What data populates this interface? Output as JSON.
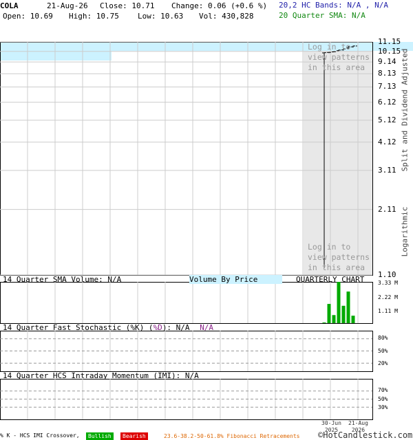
{
  "header": {
    "symbol": "COLA",
    "date": "21-Aug-26",
    "close_label": "Close: 10.71",
    "change_label": "Change: 0.06 (+0.6 %)",
    "open_label": "Open: 10.69",
    "high_label": "High: 10.75",
    "low_label": "Low: 10.63",
    "vol_label": "Vol: 430,828",
    "hc_bands": "20,2 HC Bands: N/A , N/A",
    "sma": "20 Quarter SMA: N/A"
  },
  "colors": {
    "hc_bands": "#2222aa",
    "sma": "#118811",
    "grid": "#cccccc",
    "shade": "#e8e8e8",
    "highlight": "#ccf2ff",
    "volume": "#00aa00",
    "bullish": "#00aa00",
    "bearish": "#dd0000",
    "fib": "#dd6600",
    "stoch_d": "#882288",
    "login_text": "#999999"
  },
  "side_label_top": "Split and Dividend Adjusted",
  "side_label_bottom": "Logarithmic",
  "login_text_top": [
    "Log in to",
    "view patterns",
    "in this area"
  ],
  "login_text_bottom": [
    "Log in to",
    "view patterns",
    "in this area"
  ],
  "price_axis": [
    "11.15",
    "10.15",
    "9.14",
    "8.13",
    "7.13",
    "6.12",
    "5.12",
    "4.12",
    "3.11",
    "2.11",
    "1.10"
  ],
  "volume_panel": {
    "title": "14 Quarter SMA Volume: N/A",
    "vbp": "Volume By Price",
    "chart_type": "QUARTERLY CHART",
    "axis": [
      "3.33 M",
      "2.22 M",
      "1.11 M"
    ]
  },
  "stoch_panel": {
    "title_a": "14 Quarter Fast Stochastic (",
    "k": "%K",
    "mid": ") (",
    "d": "%D",
    "title_b": "): N/A",
    "d_value": "N/A",
    "axis": [
      "80%",
      "50%",
      "20%"
    ]
  },
  "imi_panel": {
    "title": "14 Quarter HCS Intraday Momentum (IMI): N/A",
    "axis": [
      "70%",
      "50%",
      "30%"
    ]
  },
  "x_axis": [
    {
      "line1": "30-Jun",
      "line2": "2025"
    },
    {
      "line1": "21-Aug",
      "line2": "2026"
    }
  ],
  "footer": {
    "crossover": "% K - HCS IMI Crossover,",
    "bullish": "Bullish",
    "bearish": "Bearish",
    "fib": "23.6-38.2-50-61.8% Fibonacci Retracements",
    "copyright": "©HotCandlestick.com"
  },
  "chart_data": {
    "type": "bar",
    "price_scale": "log",
    "price_range": [
      1.1,
      11.15
    ],
    "price_ticks": [
      11.15,
      10.15,
      9.14,
      8.13,
      7.13,
      6.12,
      5.12,
      4.12,
      3.11,
      2.11,
      1.1
    ],
    "price_bars": [
      {
        "o": 10.0,
        "h": 10.05,
        "l": 1.18,
        "c": 10.02
      },
      {
        "o": 10.04,
        "h": 10.08,
        "l": 9.98,
        "c": 10.05
      },
      {
        "o": 10.1,
        "h": 10.16,
        "l": 10.06,
        "c": 10.12
      },
      {
        "o": 10.22,
        "h": 10.32,
        "l": 10.18,
        "c": 10.28
      },
      {
        "o": 10.3,
        "h": 10.48,
        "l": 10.25,
        "c": 10.4
      },
      {
        "o": 10.5,
        "h": 10.7,
        "l": 10.4,
        "c": 10.62
      },
      {
        "o": 10.62,
        "h": 10.75,
        "l": 10.55,
        "c": 10.71
      }
    ],
    "volume_unit": "M",
    "volume_range": [
      0,
      3.33
    ],
    "volumes": [
      0.05,
      1.55,
      0.65,
      3.33,
      1.4,
      2.55,
      0.6
    ],
    "stoch_levels": [
      80,
      50,
      20
    ],
    "imi_levels": [
      70,
      50,
      30
    ],
    "x_labels": [
      "30-Jun 2025",
      "21-Aug 2026"
    ]
  }
}
